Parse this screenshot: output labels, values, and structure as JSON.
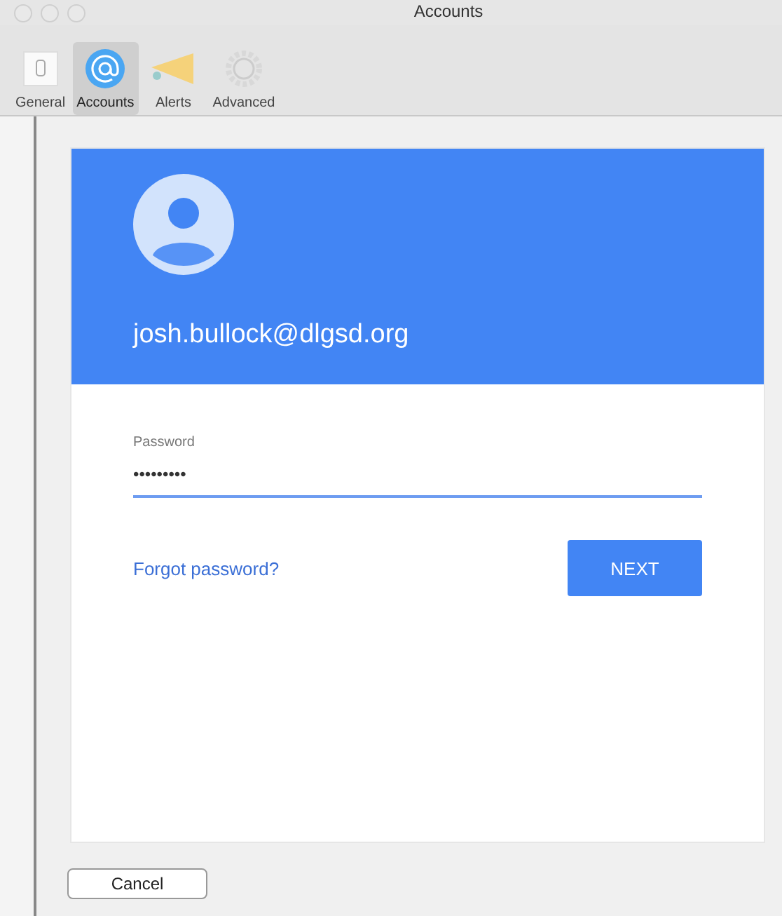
{
  "window": {
    "title": "Accounts"
  },
  "tabs": [
    {
      "label": "General",
      "kind": "general",
      "selected": false
    },
    {
      "label": "Accounts",
      "kind": "accounts",
      "selected": true
    },
    {
      "label": "Alerts",
      "kind": "alerts",
      "selected": false
    },
    {
      "label": "Advanced",
      "kind": "advanced",
      "selected": false
    }
  ],
  "signin": {
    "email": "josh.bullock@dlgsd.org",
    "password_label": "Password",
    "password_value": "•••••••••",
    "forgot_link": "Forgot password?",
    "next_button": "NEXT"
  },
  "buttons": [
    "Cancel"
  ]
}
